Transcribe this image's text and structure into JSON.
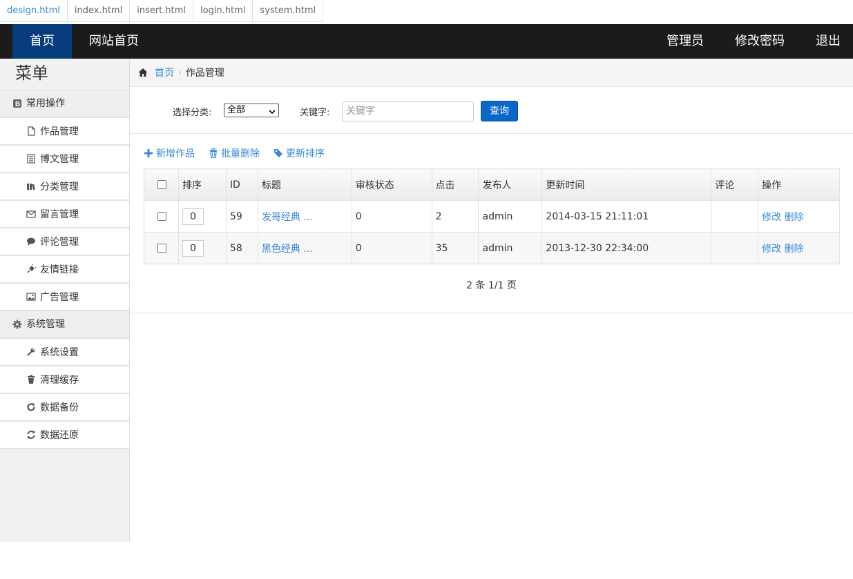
{
  "file_tabs": [
    "design.html",
    "index.html",
    "insert.html",
    "login.html",
    "system.html"
  ],
  "navbar": {
    "left": [
      "首页",
      "网站首页"
    ],
    "right": [
      "管理员",
      "修改密码",
      "退出"
    ]
  },
  "sidebar": {
    "title": "菜单",
    "groups": [
      {
        "label": "常用操作",
        "icon": "bold-icon",
        "items": [
          {
            "label": "作品管理",
            "icon": "file-icon"
          },
          {
            "label": "博文管理",
            "icon": "list-icon"
          },
          {
            "label": "分类管理",
            "icon": "books-icon"
          },
          {
            "label": "留言管理",
            "icon": "envelope-icon"
          },
          {
            "label": "评论管理",
            "icon": "comment-icon"
          },
          {
            "label": "友情链接",
            "icon": "plug-icon"
          },
          {
            "label": "广告管理",
            "icon": "image-icon"
          }
        ]
      },
      {
        "label": "系统管理",
        "icon": "gear-icon",
        "items": [
          {
            "label": "系统设置",
            "icon": "wrench-icon"
          },
          {
            "label": "清理缓存",
            "icon": "trash-icon"
          },
          {
            "label": "数据备份",
            "icon": "refresh-icon"
          },
          {
            "label": "数据还原",
            "icon": "sync-icon"
          }
        ]
      }
    ]
  },
  "breadcrumb": {
    "home": "首页",
    "current": "作品管理"
  },
  "filter": {
    "category_label": "选择分类:",
    "category_value": "全部",
    "keyword_label": "关键字:",
    "keyword_placeholder": "关键字",
    "search_button": "查询"
  },
  "actions": [
    {
      "label": "新增作品",
      "icon": "plus-icon"
    },
    {
      "label": "批量删除",
      "icon": "trash-icon"
    },
    {
      "label": "更新排序",
      "icon": "tag-icon"
    }
  ],
  "table": {
    "headers": [
      "排序",
      "ID",
      "标题",
      "审核状态",
      "点击",
      "发布人",
      "更新时间",
      "评论",
      "操作"
    ],
    "rows": [
      {
        "sort": "0",
        "id": "59",
        "title": "发哥经典 ...",
        "status": "0",
        "clicks": "2",
        "author": "admin",
        "updated": "2014-03-15 21:11:01",
        "comments": "",
        "edit": "修改",
        "delete": "删除"
      },
      {
        "sort": "0",
        "id": "58",
        "title": "黑色经典 ...",
        "status": "0",
        "clicks": "35",
        "author": "admin",
        "updated": "2013-12-30 22:34:00",
        "comments": "",
        "edit": "修改",
        "delete": "删除"
      }
    ]
  },
  "pager": "2 条 1/1 页",
  "colors": {
    "navbar": "#1b1b1b",
    "nav_active": "#063c7b",
    "link": "#3a8ad6",
    "button": "#0a67c9"
  }
}
